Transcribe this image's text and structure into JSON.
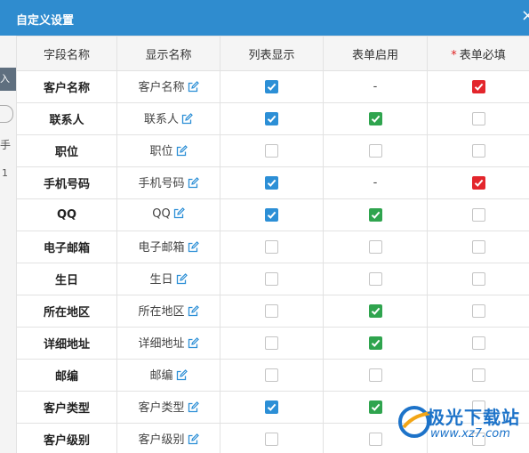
{
  "dialog": {
    "title": "自定义设置",
    "close_glyph": "×"
  },
  "background": {
    "fragment_1": "入",
    "fragment_2": "手",
    "fragment_3": "1"
  },
  "columns": {
    "field_name": "字段名称",
    "display_name": "显示名称",
    "list_display": "列表显示",
    "form_enabled": "表单启用",
    "required_mark": "*",
    "form_required": "表单必填"
  },
  "colors": {
    "title_bar": "#2f8ccf",
    "checked_list": "#2c8fd6",
    "checked_form": "#2fa44e",
    "checked_required": "#e3262c"
  },
  "rows": [
    {
      "field": "客户名称",
      "display": "客户名称",
      "list_display": true,
      "form_enabled": null,
      "form_required": true
    },
    {
      "field": "联系人",
      "display": "联系人",
      "list_display": true,
      "form_enabled": true,
      "form_required": false
    },
    {
      "field": "职位",
      "display": "职位",
      "list_display": false,
      "form_enabled": false,
      "form_required": false
    },
    {
      "field": "手机号码",
      "display": "手机号码",
      "list_display": true,
      "form_enabled": null,
      "form_required": true
    },
    {
      "field": "QQ",
      "display": "QQ",
      "list_display": true,
      "form_enabled": true,
      "form_required": false
    },
    {
      "field": "电子邮箱",
      "display": "电子邮箱",
      "list_display": false,
      "form_enabled": false,
      "form_required": false
    },
    {
      "field": "生日",
      "display": "生日",
      "list_display": false,
      "form_enabled": false,
      "form_required": false
    },
    {
      "field": "所在地区",
      "display": "所在地区",
      "list_display": false,
      "form_enabled": true,
      "form_required": false
    },
    {
      "field": "详细地址",
      "display": "详细地址",
      "list_display": false,
      "form_enabled": true,
      "form_required": false
    },
    {
      "field": "邮编",
      "display": "邮编",
      "list_display": false,
      "form_enabled": false,
      "form_required": false
    },
    {
      "field": "客户类型",
      "display": "客户类型",
      "list_display": true,
      "form_enabled": true,
      "form_required": false
    },
    {
      "field": "客户级别",
      "display": "客户级别",
      "list_display": false,
      "form_enabled": false,
      "form_required": false
    }
  ],
  "disabled_placeholder": "-",
  "icons": {
    "edit": "edit-icon",
    "checkmark": "checkmark-icon"
  },
  "watermark": {
    "name": "极光下载站",
    "url": "www.xz7.com"
  }
}
